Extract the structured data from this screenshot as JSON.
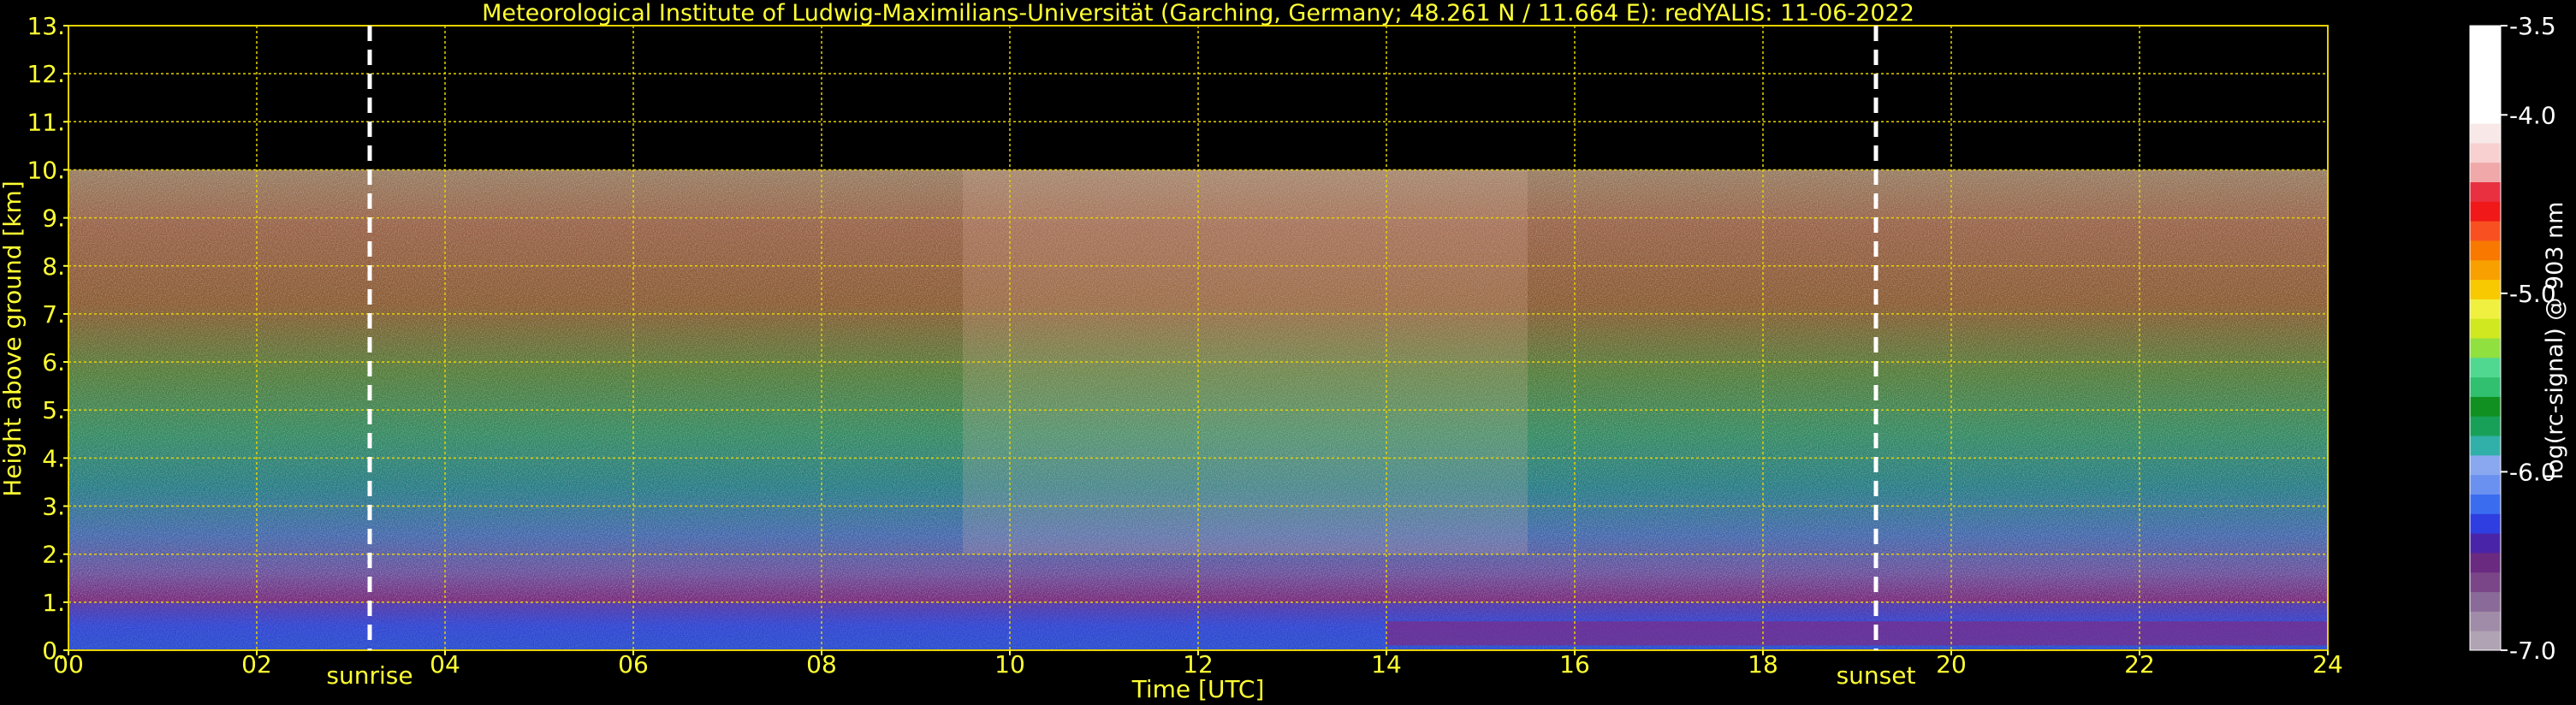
{
  "colors": {
    "text": "#ffff33",
    "grid": "#e6d200",
    "marker": "#ffffff",
    "background": "#000000"
  },
  "chart_data": {
    "type": "heatmap",
    "title": "Meteorological Institute of Ludwig-Maximilians-Universität (Garching, Germany; 48.261 N / 11.664 E):    redYALIS: 11-06-2022",
    "xlabel": "Time [UTC]",
    "ylabel": "Height above ground [km]",
    "xlim": [
      0,
      24
    ],
    "ylim": [
      0,
      13
    ],
    "x_ticks": [
      {
        "v": 0,
        "label": "00"
      },
      {
        "v": 2,
        "label": "02"
      },
      {
        "v": 4,
        "label": "04"
      },
      {
        "v": 6,
        "label": "06"
      },
      {
        "v": 8,
        "label": "08"
      },
      {
        "v": 10,
        "label": "10"
      },
      {
        "v": 12,
        "label": "12"
      },
      {
        "v": 14,
        "label": "14"
      },
      {
        "v": 16,
        "label": "16"
      },
      {
        "v": 18,
        "label": "18"
      },
      {
        "v": 20,
        "label": "20"
      },
      {
        "v": 22,
        "label": "22"
      },
      {
        "v": 24,
        "label": "24"
      }
    ],
    "y_ticks": [
      {
        "v": 0,
        "label": "0."
      },
      {
        "v": 1,
        "label": "1."
      },
      {
        "v": 2,
        "label": "2."
      },
      {
        "v": 3,
        "label": "3."
      },
      {
        "v": 4,
        "label": "4."
      },
      {
        "v": 5,
        "label": "5."
      },
      {
        "v": 6,
        "label": "6."
      },
      {
        "v": 7,
        "label": "7."
      },
      {
        "v": 8,
        "label": "8."
      },
      {
        "v": 9,
        "label": "9."
      },
      {
        "v": 10,
        "label": "10."
      },
      {
        "v": 11,
        "label": "11."
      },
      {
        "v": 12,
        "label": "12."
      },
      {
        "v": 13,
        "label": "13."
      }
    ],
    "grid": true,
    "data_top_km": 10,
    "annotations": [
      {
        "x": 3.2,
        "label": "sunrise"
      },
      {
        "x": 19.2,
        "label": "sunset"
      }
    ],
    "colorbar": {
      "label": "log(rc-signal) @ 903 nm",
      "range": [
        -7.0,
        -3.5
      ],
      "tick_labels": [
        {
          "v": -3.5,
          "label": "-3.5"
        },
        {
          "v": -4.0,
          "label": "-4.0"
        },
        {
          "v": -5.0,
          "label": "-5.0"
        },
        {
          "v": -6.0,
          "label": "-6.0"
        },
        {
          "v": -7.0,
          "label": "-7.0"
        }
      ],
      "colors": [
        "#b0a3b3",
        "#a08ca8",
        "#8a6a98",
        "#7a4688",
        "#6a2a80",
        "#4a24a8",
        "#2e3ee0",
        "#3a6cf0",
        "#6a90f0",
        "#8aa8f0",
        "#30b0a8",
        "#18a058",
        "#109020",
        "#30c070",
        "#50d890",
        "#90e040",
        "#d0e820",
        "#f0f040",
        "#f8c800",
        "#f8a000",
        "#f87800",
        "#f85020",
        "#f01818",
        "#e83040",
        "#f0a8a8",
        "#f8d0d0",
        "#f8e8e8",
        "#ffffff",
        "#ffffff",
        "#ffffff",
        "#ffffff",
        "#ffffff"
      ]
    }
  }
}
